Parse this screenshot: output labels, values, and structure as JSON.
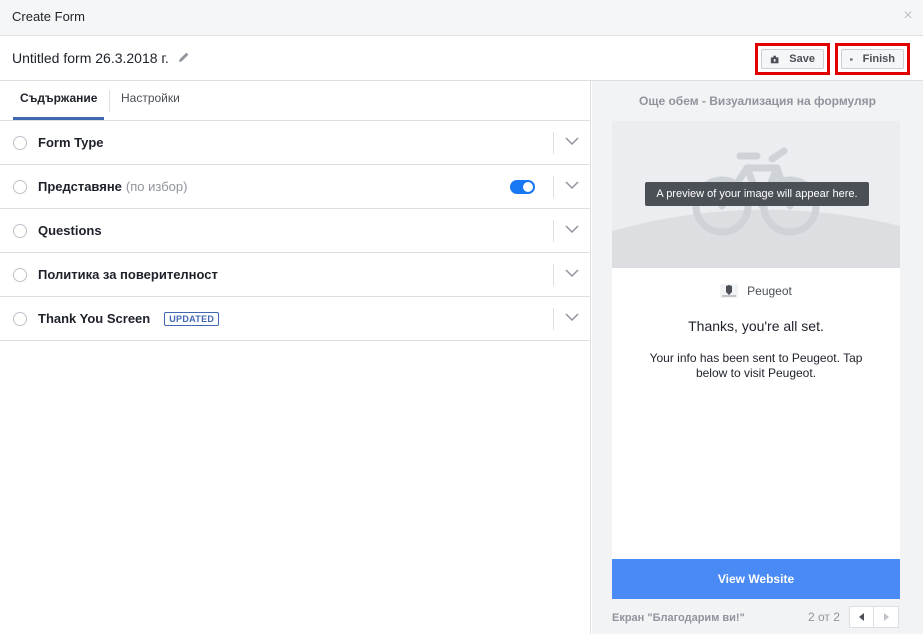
{
  "dialog": {
    "title": "Create Form",
    "close_icon": "close-icon"
  },
  "formbar": {
    "form_name": "Untitled form 26.3.2018 г.",
    "edit_icon": "pencil-icon",
    "save_label": "Save",
    "save_icon": "save-icon",
    "finish_label": "Finish",
    "finish_icon": "finish-icon"
  },
  "tabs": [
    {
      "label": "Съдържание",
      "active": true
    },
    {
      "label": "Настройки",
      "active": false
    }
  ],
  "sections": [
    {
      "label": "Form Type",
      "optional": "",
      "badge": "",
      "toggle": false
    },
    {
      "label": "Представяне",
      "optional": "(по избор)",
      "badge": "",
      "toggle": true
    },
    {
      "label": "Questions",
      "optional": "",
      "badge": "",
      "toggle": false
    },
    {
      "label": "Политика за поверителност",
      "optional": "",
      "badge": "",
      "toggle": false
    },
    {
      "label": "Thank You Screen",
      "optional": "",
      "badge": "UPDATED",
      "toggle": false
    }
  ],
  "preview": {
    "title": "Още обем - Визуализация на формуляр",
    "image_tooltip": "A preview of your image will appear here.",
    "brand_name": "Peugeot",
    "thanks_text": "Thanks, you're all set.",
    "info_text": "Your info has been sent to Peugeot. Tap below to visit Peugeot.",
    "cta_label": "View Website",
    "footer_label": "Екран \"Благодарим ви!\"",
    "page_count": "2 от 2"
  },
  "colors": {
    "accent": "#4267b2",
    "cta": "#4a8af4",
    "toggle_on": "#1877f2",
    "highlight_border": "#e00000"
  }
}
